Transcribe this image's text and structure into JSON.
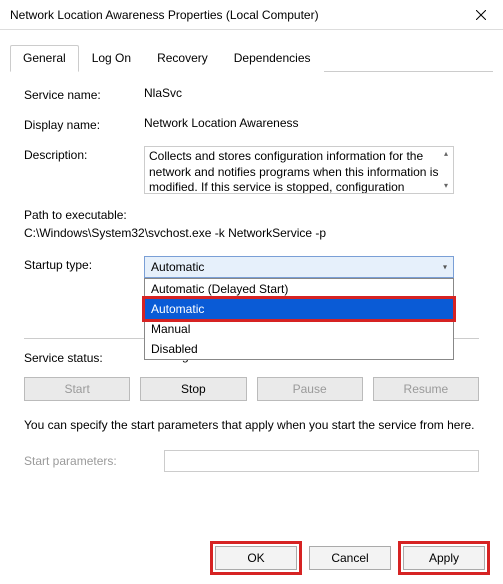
{
  "window": {
    "title": "Network Location Awareness Properties (Local Computer)"
  },
  "tabs": {
    "general": "General",
    "logon": "Log On",
    "recovery": "Recovery",
    "dependencies": "Dependencies"
  },
  "labels": {
    "service_name": "Service name:",
    "display_name": "Display name:",
    "description": "Description:",
    "path": "Path to executable:",
    "startup_type": "Startup type:",
    "service_status": "Service status:",
    "start_parameters": "Start parameters:"
  },
  "values": {
    "service_name": "NlaSvc",
    "display_name": "Network Location Awareness",
    "description": "Collects and stores configuration information for the network and notifies programs when this information is modified. If this service is stopped, configuration",
    "path": "C:\\Windows\\System32\\svchost.exe -k NetworkService -p",
    "startup_selected": "Automatic",
    "service_status": "Running"
  },
  "startup_options": {
    "delayed": "Automatic (Delayed Start)",
    "automatic": "Automatic",
    "manual": "Manual",
    "disabled": "Disabled"
  },
  "buttons": {
    "start": "Start",
    "stop": "Stop",
    "pause": "Pause",
    "resume": "Resume",
    "ok": "OK",
    "cancel": "Cancel",
    "apply": "Apply"
  },
  "info": "You can specify the start parameters that apply when you start the service from here."
}
